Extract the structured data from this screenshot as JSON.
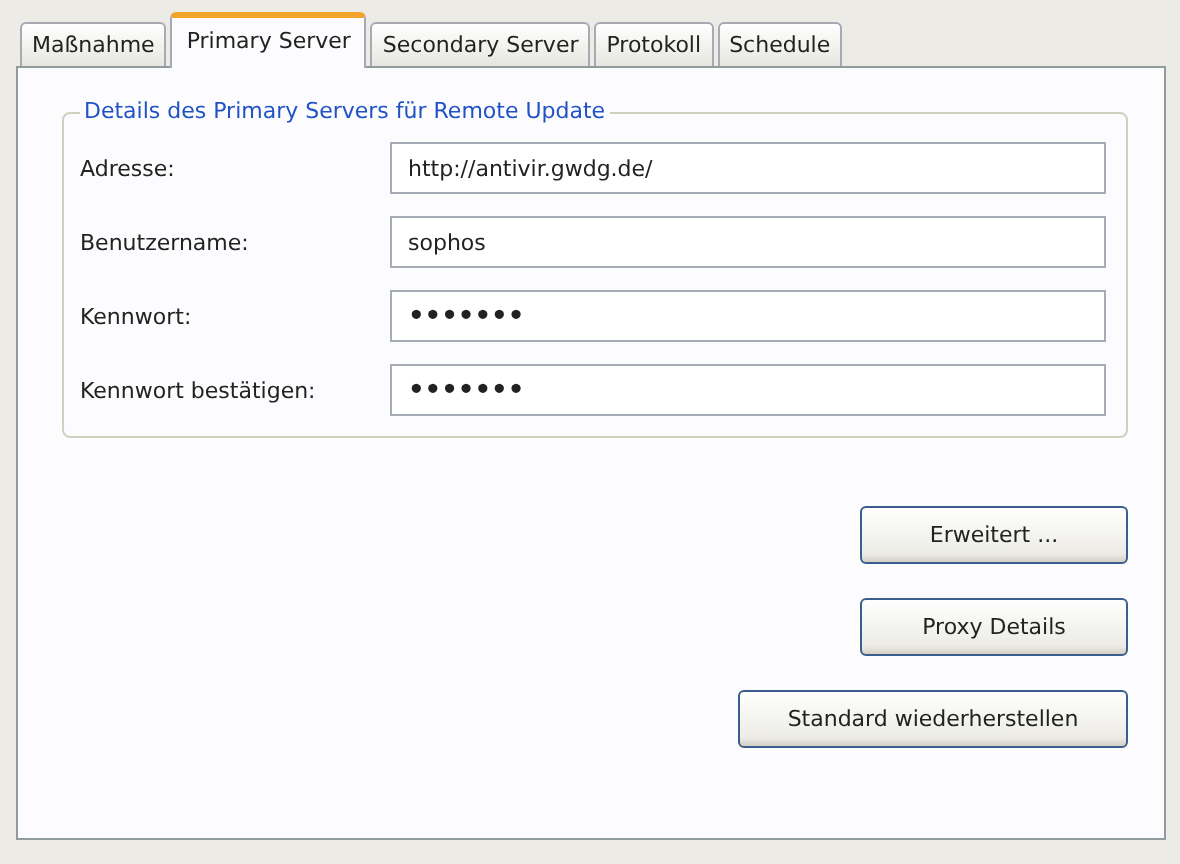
{
  "tabs": [
    {
      "label": "Maßnahme",
      "selected": false
    },
    {
      "label": "Primary Server",
      "selected": true
    },
    {
      "label": "Secondary Server",
      "selected": false
    },
    {
      "label": "Protokoll",
      "selected": false
    },
    {
      "label": "Schedule",
      "selected": false
    }
  ],
  "group": {
    "title": "Details des Primary Servers für Remote Update",
    "fields": [
      {
        "label": "Adresse:",
        "value": "http://antivir.gwdg.de/",
        "kind": "text"
      },
      {
        "label": "Benutzername:",
        "value": "sophos",
        "kind": "text"
      },
      {
        "label": "Kennwort:",
        "value": "•••••••",
        "kind": "password"
      },
      {
        "label": "Kennwort bestätigen:",
        "value": "•••••••",
        "kind": "password"
      }
    ]
  },
  "buttons": [
    "Erweitert ...",
    "Proxy Details",
    "Standard wiederherstellen"
  ]
}
